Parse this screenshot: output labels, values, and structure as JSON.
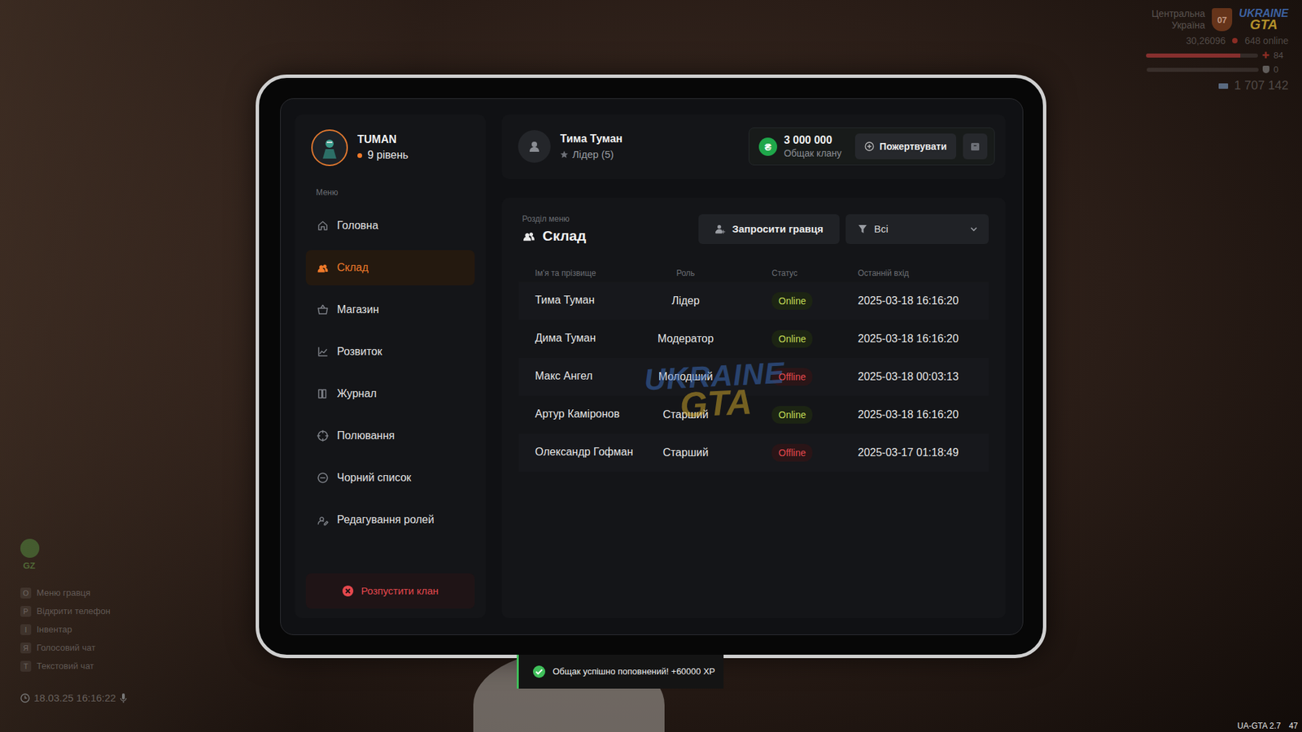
{
  "hud": {
    "region": "Центральна Україна",
    "region_badge": "07",
    "logo": {
      "line1": "UKRAINE",
      "line2": "GTA"
    },
    "player_id": "30,26096",
    "online": "648 online",
    "health": {
      "level": 0.84,
      "reading": "84"
    },
    "armor": {
      "level": 0,
      "reading": "0"
    },
    "money": "1 707 142",
    "zone_label": "GZ",
    "hints": [
      {
        "key": "O",
        "label": "Меню гравця"
      },
      {
        "key": "P",
        "label": "Відкрити телефон"
      },
      {
        "key": "I",
        "label": "Інвентар"
      },
      {
        "key": "Я",
        "label": "Голосовий чат"
      },
      {
        "key": "T",
        "label": "Текстовий чат"
      }
    ],
    "datetime": "18.03.25 16:16:22",
    "version": "UA-GTA 2.7",
    "fps": "47"
  },
  "tablet": {
    "clan": {
      "name": "TUMAN",
      "level": "9 рівень"
    },
    "menu_title": "Меню",
    "sidebar": {
      "items": [
        {
          "label": "Головна",
          "selected": false
        },
        {
          "label": "Склад",
          "selected": true
        },
        {
          "label": "Магазин",
          "selected": false
        },
        {
          "label": "Розвиток",
          "selected": false
        },
        {
          "label": "Журнал",
          "selected": false
        },
        {
          "label": "Полювання",
          "selected": false
        },
        {
          "label": "Чорний список",
          "selected": false
        },
        {
          "label": "Редагування ролей",
          "selected": false
        }
      ]
    },
    "disband_button": "Розпустити клан",
    "user": {
      "name": "Тима Туман",
      "role": "Лідер (5)"
    },
    "treasury": {
      "currency": "₴",
      "amount": "3 000 000",
      "label": "Общак клану"
    },
    "donate_button": "Пожертвувати",
    "section": {
      "caption": "Розділ меню",
      "title": "Склад"
    },
    "invite_button": "Запросити гравця",
    "filter": {
      "value": "Всі"
    },
    "table": {
      "columns": [
        "Ім'я та прізвище",
        "Роль",
        "Статус",
        "Останній вхід"
      ],
      "rows": [
        {
          "name": "Тима Туман",
          "role": "Лідер",
          "status": "Online",
          "online": true,
          "color": "#c4dd55",
          "last_login": "2025-03-18 16:16:20"
        },
        {
          "name": "Дима Туман",
          "role": "Модератор",
          "status": "Online",
          "online": true,
          "color": "#c4dd55",
          "last_login": "2025-03-18 16:16:20"
        },
        {
          "name": "Макс Ангел",
          "role": "Молодший",
          "status": "Offline",
          "online": false,
          "color": "#e5484d",
          "last_login": "2025-03-18 00:03:13"
        },
        {
          "name": "Артур Каміронов",
          "role": "Старший",
          "status": "Online",
          "online": true,
          "color": "#c4dd55",
          "last_login": "2025-03-18 16:16:20"
        },
        {
          "name": "Олександр Гофман",
          "role": "Старший",
          "status": "Offline",
          "online": false,
          "color": "#e5484d",
          "last_login": "2025-03-17 01:18:49"
        }
      ]
    }
  },
  "watermark": {
    "line1": "UKRAINE",
    "line2": "GTA"
  },
  "toast": {
    "text": "Общак успішно поповнений! +60000 XP"
  }
}
